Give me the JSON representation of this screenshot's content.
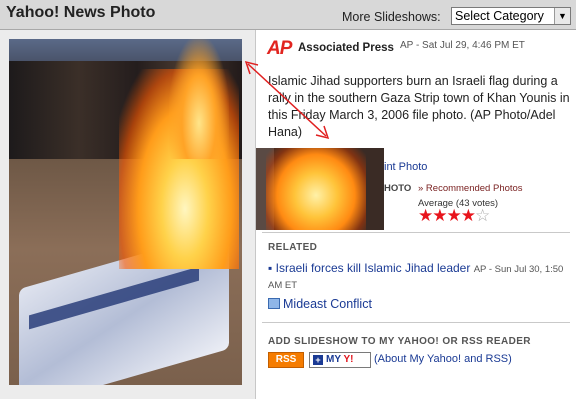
{
  "header": {
    "title": "Yahoo! News Photo",
    "more_label": "More Slideshows:",
    "select_value": "Select Category"
  },
  "story": {
    "source": "Associated Press",
    "source_mark": "AP",
    "dateline": "AP - Sat Jul 29, 4:46 PM ET",
    "caption": "Islamic Jihad supporters burn an Israeli flag during a rally in the southern Gaza Strip town of Khan Younis in this Friday March 3, 2006 file photo. (AP Photo/Adel Hana)"
  },
  "actions": {
    "print_label": "int Photo",
    "email_label": "HOTO",
    "recommended_label": "» Recommended Photos",
    "rating_text": "Average (43 votes)",
    "rating_stars": 4,
    "rating_max": 5
  },
  "related": {
    "heading": "RELATED",
    "items": [
      {
        "title": "Israeli forces kill Islamic Jihad leader",
        "meta": "AP - Sun Jul 30, 1:50 AM ET"
      }
    ],
    "topic": "Mideast Conflict"
  },
  "add_slideshow": {
    "heading": "ADD SLIDESHOW TO MY YAHOO! OR RSS READER",
    "rss_label": "RSS",
    "my_label": "MY",
    "yahoo_label": "Y!",
    "about_link": "(About My Yahoo! and RSS)"
  },
  "colors": {
    "accent_link": "#1a3a94",
    "ap_red": "#e1241f",
    "star_red": "#e8141c",
    "rss_orange": "#f57c00",
    "annotation_arrow": "#e02020"
  }
}
